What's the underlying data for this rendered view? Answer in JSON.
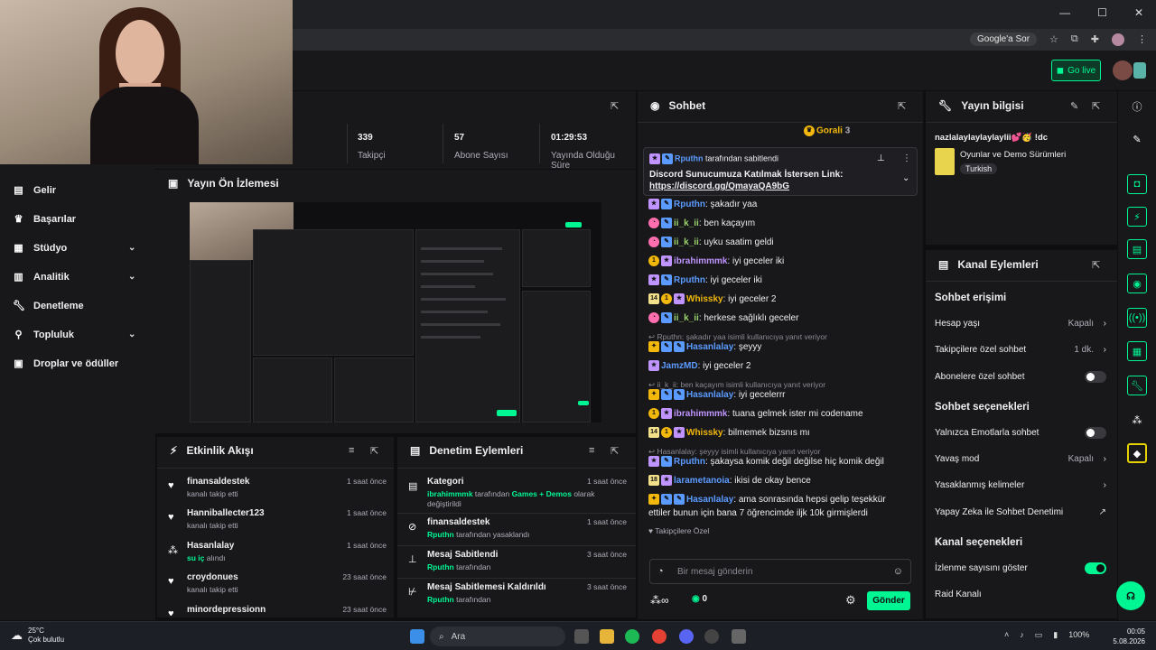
{
  "browser": {
    "window_controls": [
      "—",
      "☐",
      "✕"
    ],
    "google_btn": "Google'a Sor",
    "go_live": "Go live"
  },
  "sidebar": {
    "items": [
      {
        "label": "Gelir",
        "icon": "revenue-icon",
        "chev": false
      },
      {
        "label": "Başarılar",
        "icon": "trophy-icon",
        "chev": true
      },
      {
        "label": "Stüdyo",
        "icon": "studio-icon",
        "chev": true
      },
      {
        "label": "Analitik",
        "icon": "analytics-icon",
        "chev": true
      },
      {
        "label": "Denetleme",
        "icon": "wrench-icon",
        "chev": false
      },
      {
        "label": "Topluluk",
        "icon": "community-icon",
        "chev": true
      },
      {
        "label": "Droplar ve ödüller",
        "icon": "drops-icon",
        "chev": false
      }
    ]
  },
  "stats": {
    "items": [
      {
        "value": "339",
        "label": "Takipçi"
      },
      {
        "value": "57",
        "label": "Abone Sayısı"
      },
      {
        "value": "01:29:53",
        "label": "Yayında Olduğu Süre"
      }
    ]
  },
  "preview": {
    "title": "Yayın Ön İzlemesi"
  },
  "activity": {
    "title": "Etkinlik Akışı",
    "items": [
      {
        "name": "finansaldestek",
        "sub": "kanalı takip etti",
        "time": "1 saat önce",
        "icon": "heart-icon"
      },
      {
        "name": "Hanniballecter123",
        "sub": "kanalı takip etti",
        "time": "1 saat önce",
        "icon": "heart-icon"
      },
      {
        "name": "Hasanlalay",
        "sub_green": "su iç",
        "sub": " alındı",
        "time": "1 saat önce",
        "icon": "points-icon"
      },
      {
        "name": "croydonues",
        "sub": "kanalı takip etti",
        "time": "23 saat önce",
        "icon": "heart-icon"
      },
      {
        "name": "minordepressionn",
        "sub": "",
        "time": "23 saat önce",
        "icon": "heart-icon"
      }
    ]
  },
  "moderation": {
    "title": "Denetim Eylemleri",
    "items": [
      {
        "name": "Kategori",
        "user": "ibrahimmmk",
        "text": " tarafından ",
        "target": "Games + Demos",
        "text2": " olarak değiştirildi",
        "time": "1 saat önce",
        "icon": "category-icon"
      },
      {
        "name": "finansaldestek",
        "user": "Rputhn",
        "text": " tarafından yasaklandı",
        "time": "1 saat önce",
        "icon": "ban-icon"
      },
      {
        "name": "Mesaj Sabitlendi",
        "user": "Rputhn",
        "text": " tarafından",
        "time": "3 saat önce",
        "icon": "pin-icon"
      },
      {
        "name": "Mesaj Sabitlemesi Kaldırıldı",
        "user": "Rputhn",
        "text": " tarafından",
        "time": "3 saat önce",
        "icon": "unpin-icon"
      }
    ]
  },
  "chat": {
    "title": "Sohbet",
    "top_gifter": "Gorali",
    "top_gifter_count": "3",
    "pinned_by": "Rputhn",
    "pinned_suffix": " tarafından sabitlendi",
    "pinned_text": "Discord Sunucumuza Katılmak İstersen Link:",
    "pinned_link": "https://discord.gg/QmayaQA9bG",
    "messages": [
      {
        "user": "Rputhn",
        "color": "n1",
        "text": ": şakadır yaa",
        "badges": [
          "p",
          "b"
        ]
      },
      {
        "user": "ii_k_ii",
        "color": "n3",
        "text": ": ben kaçayım",
        "badges": [
          "pk",
          "b"
        ]
      },
      {
        "user": "ii_k_ii",
        "color": "n3",
        "text": ": uyku saatim geldi",
        "badges": [
          "pk",
          "b"
        ]
      },
      {
        "user": "ibrahimmmk",
        "color": "p",
        "text": ": iyi geceler iki",
        "badges": [
          "y1",
          "p"
        ]
      },
      {
        "user": "Rputhn",
        "color": "n1",
        "text": ": iyi geceler iki",
        "badges": [
          "p",
          "b"
        ]
      },
      {
        "user": "Whissky",
        "color": "y",
        "text": ": iyi geceler 2",
        "badges": [
          "14",
          "y1",
          "p"
        ]
      },
      {
        "user": "ii_k_ii",
        "color": "n3",
        "text": ": herkese sağlıklı geceler",
        "badges": [
          "pk",
          "b"
        ]
      },
      {
        "reply": "Rputhn: şakadır yaa isimli kullanıcıya yanıt veriyor"
      },
      {
        "user": "Hasanlalay",
        "color": "n1",
        "text": ": şeyyy",
        "badges": [
          "g",
          "b",
          "b"
        ]
      },
      {
        "user": "JamzMD",
        "color": "n1",
        "text": ": iyi geceler 2",
        "badges": [
          "p"
        ]
      },
      {
        "reply": "ii_k_ii: ben kaçayım isimli kullanıcıya yanıt veriyor"
      },
      {
        "user": "Hasanlalay",
        "color": "n1",
        "text": ": iyi gecelerrr",
        "badges": [
          "g",
          "b",
          "b"
        ]
      },
      {
        "user": "ibrahimmmk",
        "color": "p",
        "text": ": tuana gelmek ister mi codename",
        "badges": [
          "y1",
          "p"
        ]
      },
      {
        "user": "Whissky",
        "color": "y",
        "text": ": bilmemek bizsnıs mı",
        "badges": [
          "14",
          "y1",
          "p"
        ]
      },
      {
        "reply": "Hasanlalay: şeyyy isimli kullanıcıya yanıt veriyor"
      },
      {
        "user": "Rputhn",
        "color": "n1",
        "text": ": şakaysa komik değil değilse hiç komik değil",
        "badges": [
          "p",
          "b"
        ]
      },
      {
        "user": "larametanoia",
        "color": "n1",
        "text": ": ikisi de okay bence",
        "badges": [
          "18",
          "p"
        ]
      },
      {
        "user": "Hasanlalay",
        "color": "n1",
        "text": ": ama sonrasında hepsi gelip teşekkür",
        "text2": "ettiler bunun için bana 7 öğrencimde iljk 10k girmişlerdi",
        "badges": [
          "g",
          "b",
          "b"
        ]
      }
    ],
    "followers_only": "Takipçilere Özel",
    "input_placeholder": "Bir mesaj gönderin",
    "points": "0",
    "send": "Gönder"
  },
  "info": {
    "title": "Yayın bilgisi",
    "stream_title": "nazlalaylaylaylaylii💕🥳 !dc",
    "category": "Oyunlar ve Demo Sürümleri",
    "tag": "Turkish"
  },
  "kanal": {
    "title": "Kanal Eylemleri",
    "sections": [
      {
        "head": "Sohbet erişimi",
        "rows": [
          {
            "label": "Hesap yaşı",
            "value": "Kapalı",
            "kind": "arrow"
          },
          {
            "label": "Takipçilere özel sohbet",
            "value": "1 dk.",
            "kind": "arrow-green"
          },
          {
            "label": "Abonelere özel sohbet",
            "value": "",
            "kind": "toggle-off"
          }
        ]
      },
      {
        "head": "Sohbet seçenekleri",
        "rows": [
          {
            "label": "Yalnızca Emotlarla sohbet",
            "value": "",
            "kind": "toggle-off"
          },
          {
            "label": "Yavaş mod",
            "value": "Kapalı",
            "kind": "arrow"
          },
          {
            "label": "Yasaklanmış kelimeler",
            "value": "",
            "kind": "arrow"
          },
          {
            "label": "Yapay Zeka ile Sohbet Denetimi",
            "value": "",
            "kind": "external"
          }
        ]
      },
      {
        "head": "Kanal seçenekleri",
        "rows": [
          {
            "label": "İzlenme sayısını göster",
            "value": "",
            "kind": "toggle-on"
          },
          {
            "label": "Raid Kanalı",
            "value": "",
            "kind": "none"
          }
        ]
      }
    ]
  },
  "taskbar": {
    "temp": "25°C",
    "weather": "Çok bulutlu",
    "search": "Ara",
    "battery": "100%",
    "time": "00:05",
    "date": "5.08.2026"
  },
  "colors": {
    "accent": "#00f593",
    "bg": "#18181b"
  }
}
